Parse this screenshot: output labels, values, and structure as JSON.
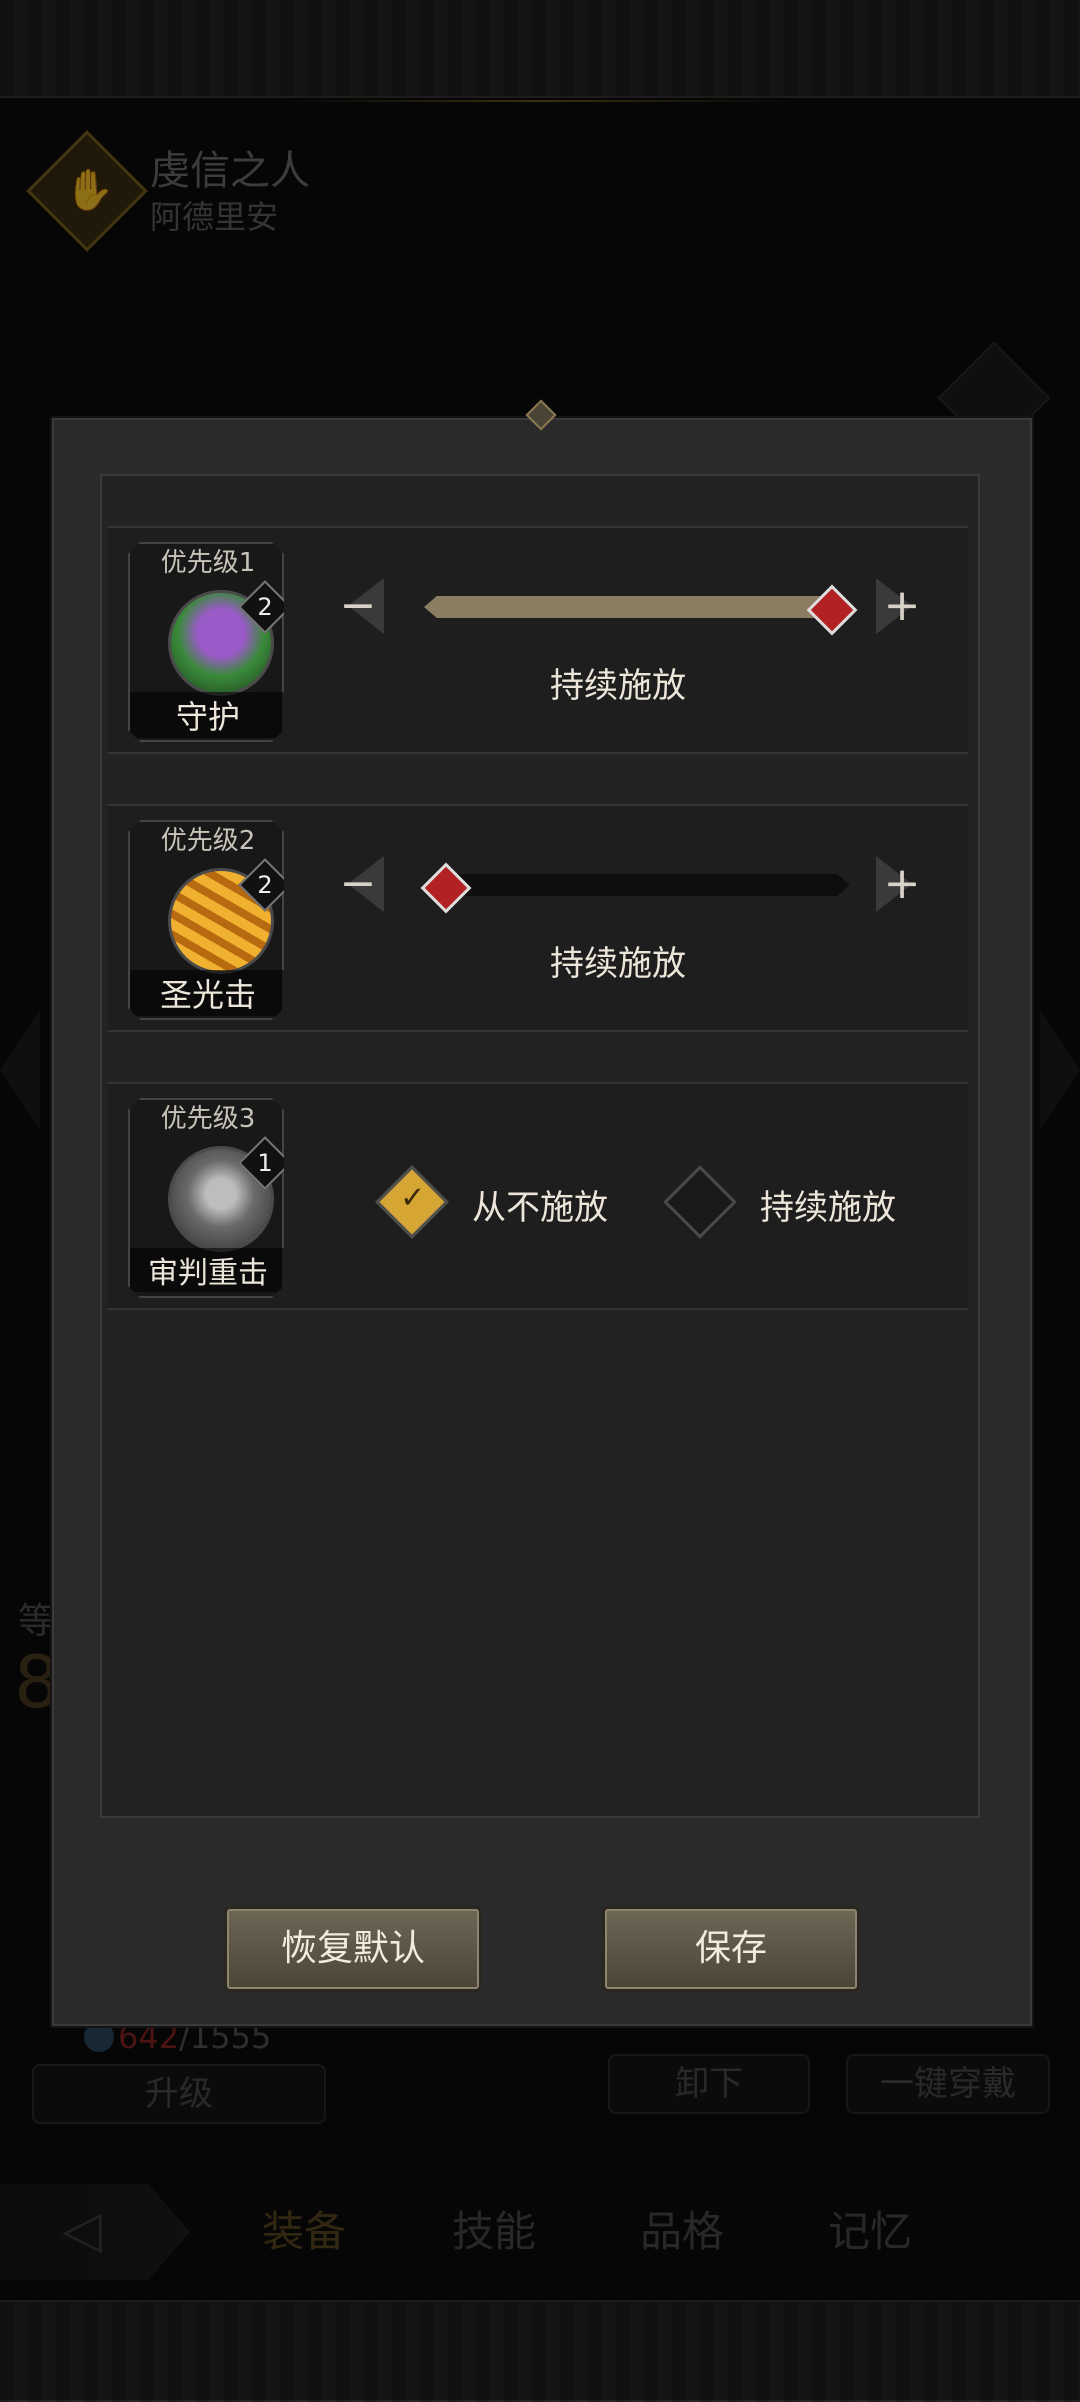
{
  "header": {
    "title": "虔信之人",
    "subtitle": "阿德里安"
  },
  "background": {
    "exp_current": "642",
    "exp_max": "/1555",
    "level_prefix": "等",
    "level_value": "8",
    "upgrade_label": "升级",
    "unequip_label": "卸下",
    "equip_all_label": "一键穿戴"
  },
  "nav": {
    "tabs": [
      "装备",
      "技能",
      "品格",
      "记忆"
    ],
    "active": "装备"
  },
  "dialog": {
    "skills": [
      {
        "priority": "优先级1",
        "name": "守护",
        "level": "2",
        "mode_label": "持续施放",
        "slider_value": 1.0
      },
      {
        "priority": "优先级2",
        "name": "圣光击",
        "level": "2",
        "mode_label": "持续施放",
        "slider_value": 0.0
      },
      {
        "priority": "优先级3",
        "name": "审判重击",
        "level": "1",
        "options": [
          "从不施放",
          "持续施放"
        ],
        "selected": "从不施放"
      }
    ],
    "reset_label": "恢复默认",
    "save_label": "保存"
  },
  "colors": {
    "accent_gold": "#d5a633",
    "thumb_red": "#b32222",
    "exp_red": "#8a2323"
  }
}
